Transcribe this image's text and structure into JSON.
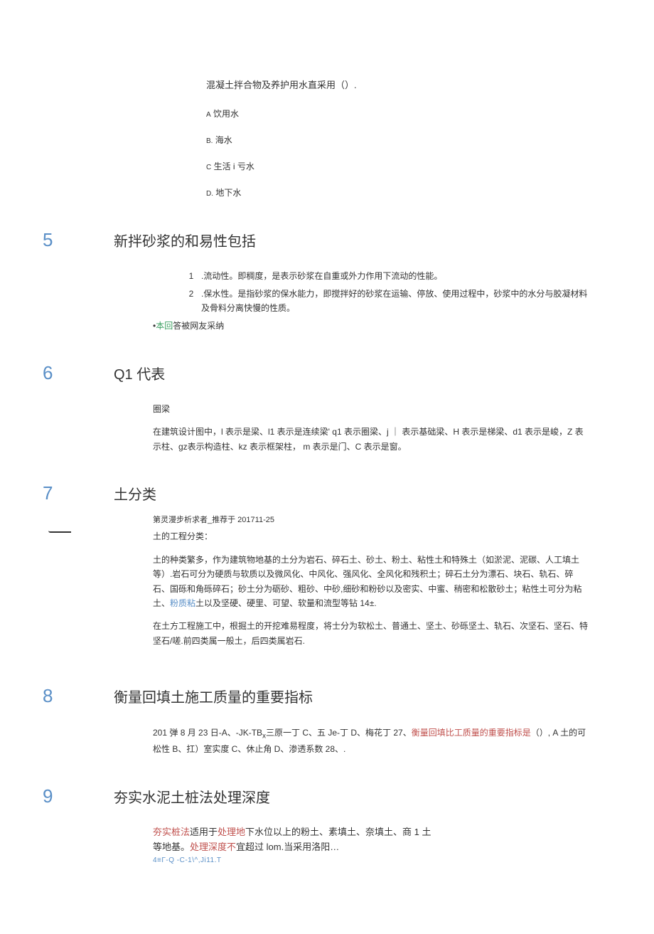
{
  "q4": {
    "stem": "混凝土拌合物及养护用水直采用（）.",
    "a_pre": "A",
    "a": "饮用水",
    "b_pre": "B.",
    "b": "海水",
    "c_pre": "C",
    "c": "生活 i 亏水",
    "d_pre": "D.",
    "d": "地下水"
  },
  "s5": {
    "num": "5",
    "title": "新拌砂浆的和易性包括",
    "item1_num": "1",
    "item1": " .流动性。即稠度，是表示砂浆在自重或外力作用下流动的性能。",
    "item2_num": "2",
    "item2": " .保水性。是指砂浆的保水能力，即搅拌好的砂浆在运输、停放、使用过程中，砂浆中的水分与胶凝材料及骨料分离快慢的性质。",
    "note_pre": "•",
    "note_g": "本回",
    "note_rest": "答被网友采纳"
  },
  "s6": {
    "num": "6",
    "title": "Q1 代表",
    "l1": "圈梁",
    "l2": "在建筑设计图中，l 表示是梁、l1 表示是连续梁' q1 表示圈梁、j ｜ 表示基础梁、H 表示是梯梁、d1 表示是峻，Z 表示柱、gz表示构造柱、kz 表示框架柱， m 表示是门、C 表示是窗。"
  },
  "s7": {
    "num": "7",
    "title": "土分类",
    "meta": "第灵漫步析求者_推荐于 201711-25",
    "l1": "土的工程分类：",
    "l2a": "土的种类繁多，作为建筑物地基的土分为岩石、碎石土、砂土、粉土、粘性土和特殊土（如淤泥、泥碳、人工填土等）.岩石可分为硬质与软质以及微风化、中风化、强风化、全风化和残积土；碎石土分为漂石、块石、轨石、碎石、国砾和角砾碎石；砂土分为砺砂、粗砂、中砂,细砂和粉砂以及密实、中蜜、稍密和松散砂土；粘性土可分为粘土、",
    "l2b": "粉质粘",
    "l2c": "土以及坚硬、硬里、可望、软量和流型等钻 14±.",
    "l3": "在土方工程施工中，根掘土的开挖难易程度，将士分为软松土、普通土、坚土、砂砾坚土、轨石、次坚石、坚石、特坚石/嗟.前四类属一般土，后四类属岩石."
  },
  "s8": {
    "num": "8",
    "title": "衡量回填土施工质量的重要指标",
    "p_a": "201 弹 8 月 23 日-A、-JK-TB",
    "p_x": "x",
    "p_b": "三原一丁 C、五 Je-丁 D、梅花丁 27、",
    "p_red": "衡量回填比工质量的重要指标是",
    "p_c": "（）, A 土的可松性 B、扛）室实度 C、休止角 D、渗透系数 28、."
  },
  "s9": {
    "num": "9",
    "title": "夯实水泥土桩法处理深度",
    "r1": "夯实桩法",
    "t1": "适用于",
    "r2": "处理地",
    "t2": "下水位以上的粉土、素填土、奈填土、商 1 土",
    "t3": "等地基。",
    "r3": "处理深度不",
    "t4": "宜超过 lom.当采用洛阳…",
    "meta": "4≡Γ-Q     -C-1\\^,Ji11.T"
  }
}
